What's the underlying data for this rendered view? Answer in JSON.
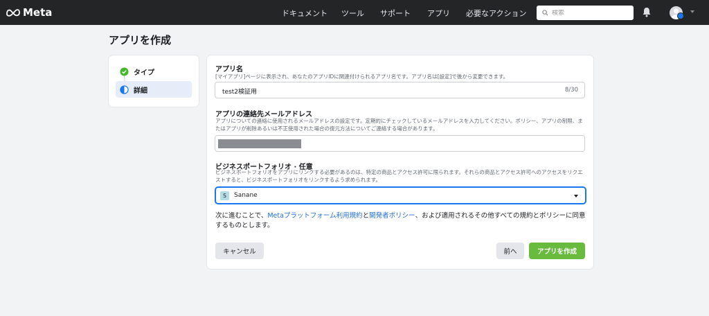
{
  "header": {
    "brand": "Meta",
    "nav": [
      "ドキュメント",
      "ツール",
      "サポート",
      "アプリ",
      "必要なアクション"
    ],
    "search_placeholder": "検索"
  },
  "page_title": "アプリを作成",
  "steps": [
    {
      "label": "タイプ",
      "state": "done"
    },
    {
      "label": "詳細",
      "state": "active"
    }
  ],
  "form": {
    "app_name": {
      "label": "アプリ名",
      "description": "[マイアプリ]ページに表示され、あなたのアプリIDに関連付けられるアプリ名です。アプリ名は[設定]で後から変更できます。",
      "value": "test2検証用",
      "counter": "8/30"
    },
    "contact_email": {
      "label": "アプリの連絡先メールアドレス",
      "description": "アプリについての連絡に使用されるメールアドレスの設定です。定期的にチェックしているメールアドレスを入力してください。ポリシー、アプリの制限、またはアプリが削除あるいは不正使用された場合の復元方法についてご連絡する場合があります。"
    },
    "business_portfolio": {
      "label": "ビジネスポートフォリオ · 任意",
      "description": "ビジネスポートフォリオをアプリにリンクする必要があるのは、特定の商品とアクセス許可に限られます。それらの商品とアクセス許可へのアクセスをリクエストすると、ビジネスポートフォリオをリンクするよう求められます。",
      "selected_initial": "S",
      "selected": "Sanane"
    },
    "terms": {
      "prefix": "次に進むことで、",
      "link1": "Metaプラットフォーム利用規約",
      "middle": "と",
      "link2": "開発者ポリシー",
      "suffix": "、および適用されるその他すべての規約とポリシーに同意するものとします。"
    },
    "buttons": {
      "cancel": "キャンセル",
      "back": "前へ",
      "create": "アプリを作成"
    }
  },
  "colors": {
    "header_bg": "#242526",
    "accent_green": "#69bb3e",
    "link_blue": "#216fdb",
    "highlight_red": "#e8312a"
  }
}
